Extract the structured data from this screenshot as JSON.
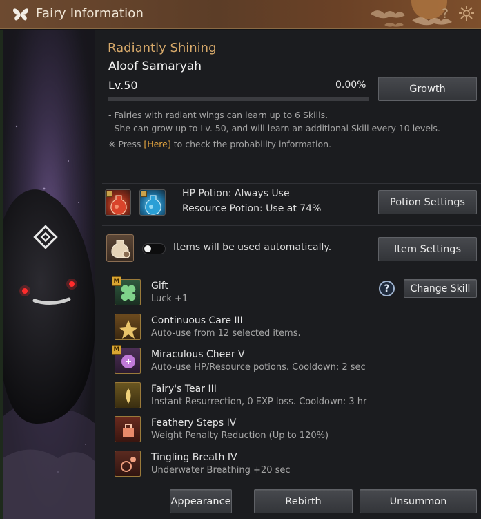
{
  "window": {
    "title": "Fairy Information",
    "help_glyph": "?",
    "icons": [
      "butterfly-icon",
      "help-icon",
      "close-icon"
    ]
  },
  "fairy": {
    "rank": "Radiantly Shining",
    "name": "Aloof Samaryah",
    "level": "Lv.50",
    "exp_percent": "0.00%",
    "exp_fraction": 0.0,
    "growth_label": "Growth",
    "desc_line1": "- Fairies with radiant wings can learn up to 6 Skills.",
    "desc_line2": "- She can grow up to Lv. 50, and will learn an additional Skill every 10 levels.",
    "desc_line3_prefix": "※ Press ",
    "desc_line3_link": "[Here]",
    "desc_line3_suffix": " to check the probability information."
  },
  "potions": {
    "hp_text": "HP Potion: Always Use",
    "resource_text": "Resource Potion: Use at 74%",
    "settings_label": "Potion Settings"
  },
  "items": {
    "auto_text": "Items will be used automatically.",
    "toggle_on": false,
    "settings_label": "Item Settings"
  },
  "skills": {
    "help_glyph": "?",
    "change_label": "Change Skill",
    "list": [
      {
        "name": "Gift",
        "desc": "Luck +1",
        "badge": "M"
      },
      {
        "name": "Continuous Care III",
        "desc": "Auto-use from 12 selected items.",
        "badge": ""
      },
      {
        "name": "Miraculous Cheer V",
        "desc": "Auto-use HP/Resource potions. Cooldown: 2 sec",
        "badge": "M"
      },
      {
        "name": "Fairy's Tear III",
        "desc": "Instant Resurrection, 0 EXP loss. Cooldown: 3 hr",
        "badge": ""
      },
      {
        "name": "Feathery Steps IV",
        "desc": "Weight Penalty Reduction (Up to 120%)",
        "badge": ""
      },
      {
        "name": "Tingling Breath IV",
        "desc": "Underwater Breathing +20 sec",
        "badge": ""
      }
    ]
  },
  "footer": {
    "appearance_label": "Appearance",
    "rebirth_label": "Rebirth",
    "unsummon_label": "Unsummon"
  },
  "colors": {
    "accent_gold": "#d7a96a",
    "link_orange": "#e3a43f",
    "title_bar": "#5c3d27"
  }
}
